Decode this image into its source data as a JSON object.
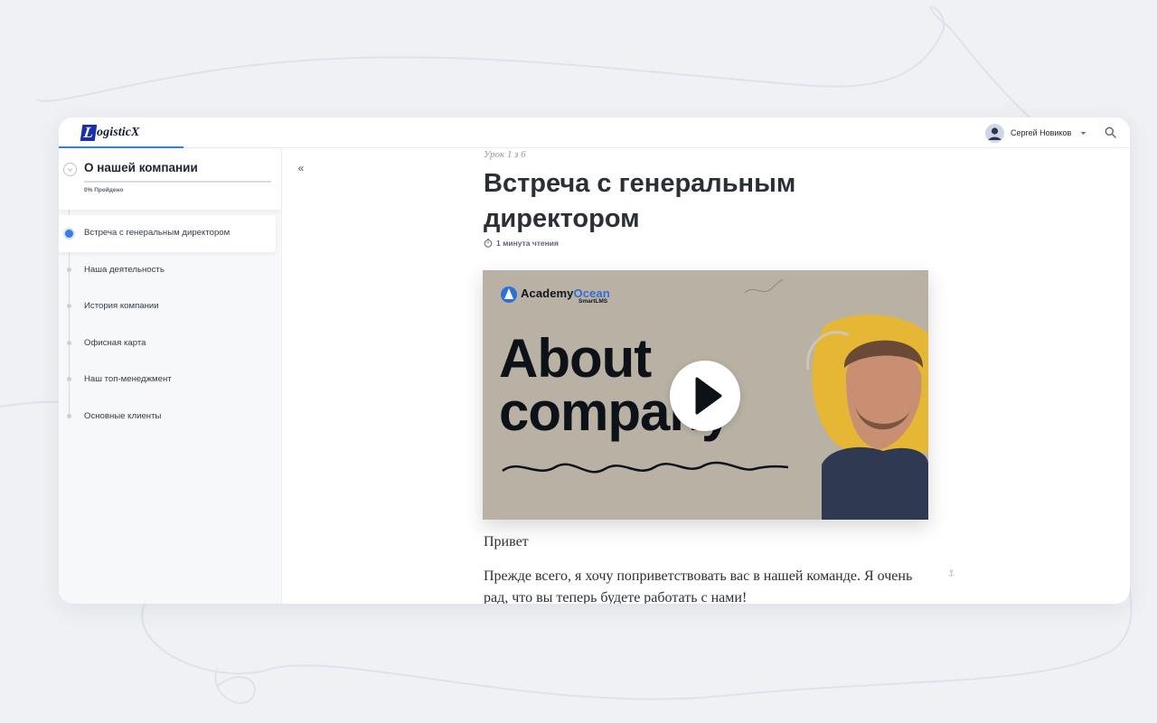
{
  "app": {
    "logo_mark": "L",
    "logo_text": "ogisticX"
  },
  "header": {
    "user_name": "Сергей Новиков",
    "user_menu_icon": "caret-down-icon",
    "search_icon": "search-icon"
  },
  "sidebar": {
    "course_title": "О нашей компании",
    "progress_label": "0% Пройдено",
    "progress_fraction": 0.0,
    "collapse_label": "«",
    "lessons": [
      {
        "label": "Встреча с генеральным директором",
        "active": true
      },
      {
        "label": "Наша деятельность",
        "active": false
      },
      {
        "label": "История компании",
        "active": false
      },
      {
        "label": "Офисная карта",
        "active": false
      },
      {
        "label": "Наш топ-менеджмент",
        "active": false
      },
      {
        "label": "Основные клиенты",
        "active": false
      }
    ]
  },
  "lesson": {
    "counter": "Урок 1 з 6",
    "title": "Встреча с генеральным директором",
    "read_time": "1 минута чтения",
    "video": {
      "brand_prefix": "Academy",
      "brand_accent": "Ocean",
      "brand_sub": "SmartLMS",
      "line1": "About",
      "line2": "company"
    },
    "greeting": "Привет",
    "body": "Прежде всего, я хочу поприветствовать вас в нашей команде. Я очень рад, что вы теперь будете работать с нами!"
  },
  "colors": {
    "accent": "#3a7bea",
    "logo_blue": "#1b2fa8",
    "video_bg": "#b8b1a4",
    "video_blob": "#e6b635"
  }
}
